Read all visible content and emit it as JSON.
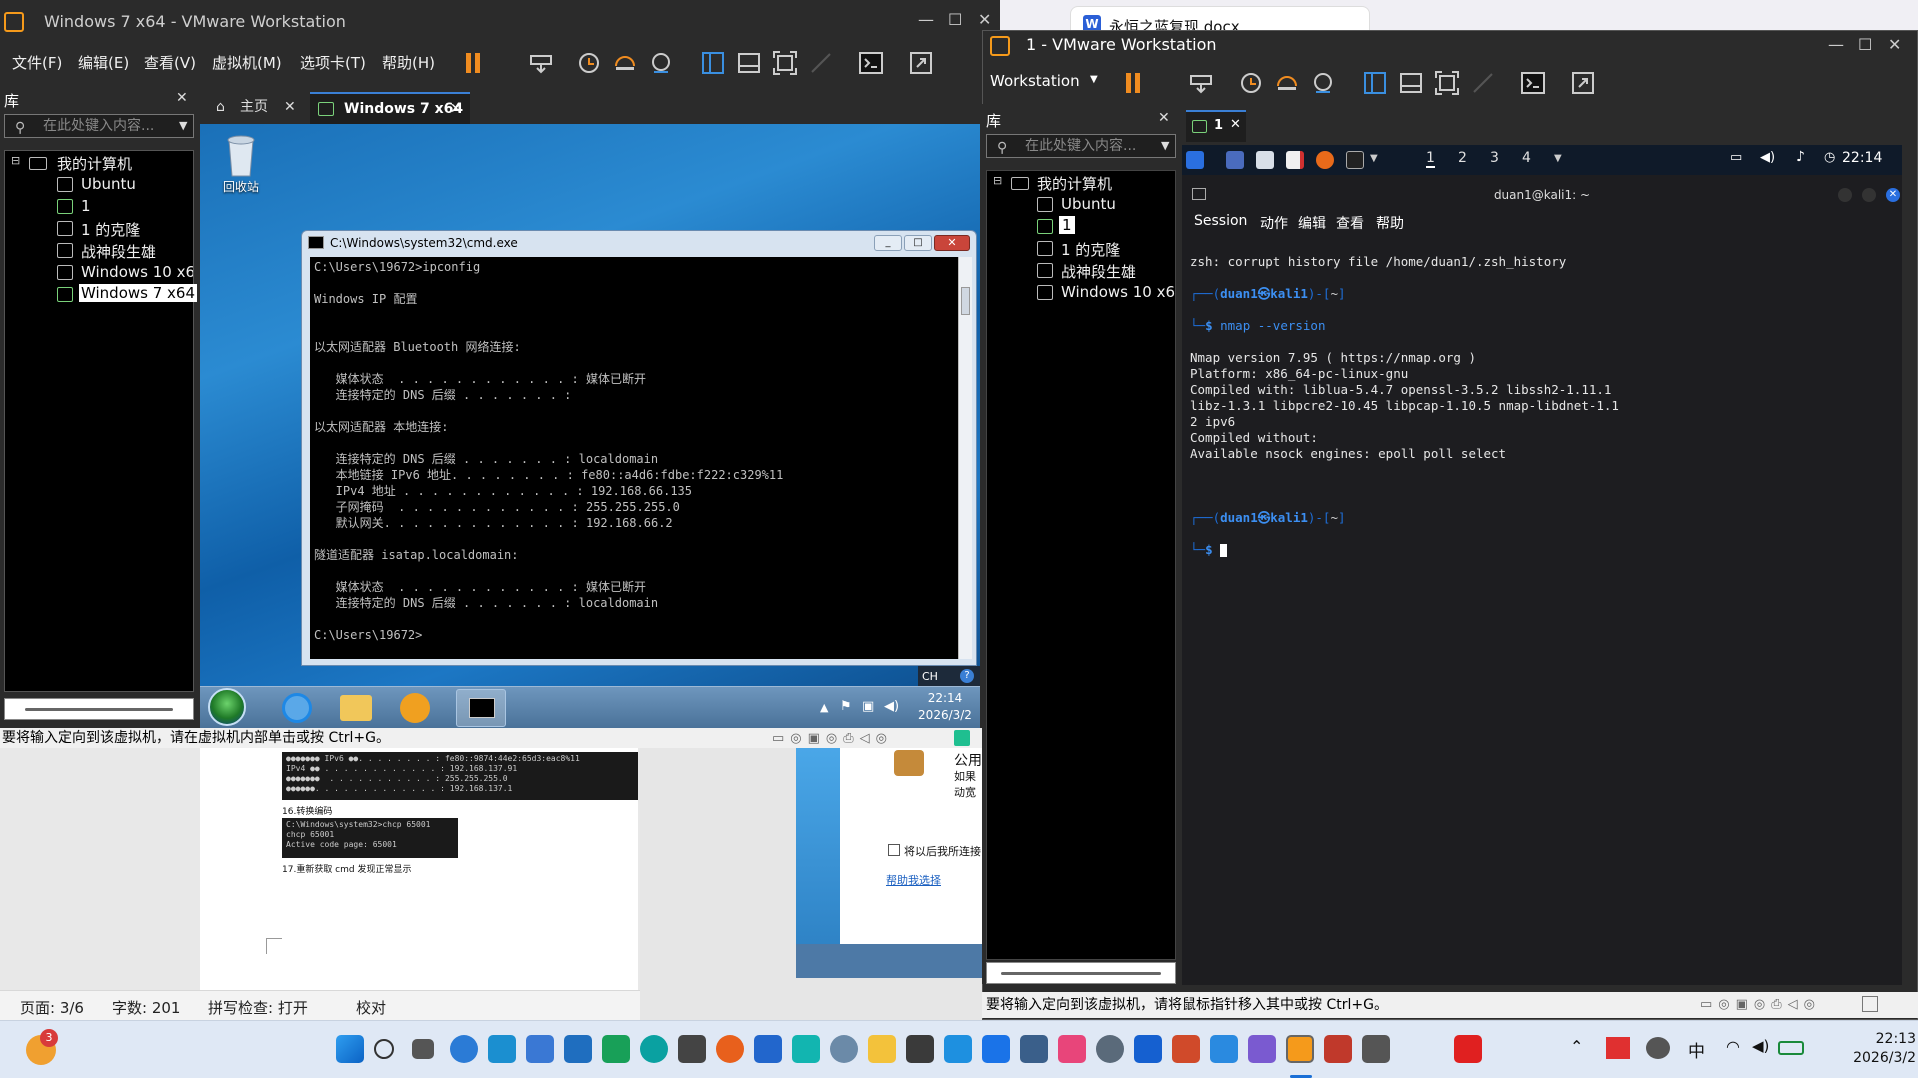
{
  "word_tab": {
    "title": "永恒之蓝复现.docx"
  },
  "word": {
    "status_page": "页面: 3/6",
    "status_words": "字数: 201",
    "status_spell": "拼写检查: 打开",
    "status_proof": "校对",
    "doc_img1": "●●●●●●● IPv6 ●●. . . . . . . . : fe80::9874:44e2:65d3:eac8%11\nIPv4 ●● . . . . . . . . . . . . : 192.168.137.91\n●●●●●●●  . . . . . . . . . . . : 255.255.255.0\n●●●●●●. . . . . . . . . . . . . : 192.168.137.1",
    "caption16": "16.转换编码",
    "doc_img2": "C:\\Windows\\system32>chcp 65001\nchcp 65001\nActive code page: 65001",
    "caption17": "17.重新获取 cmd 发现正常显示"
  },
  "vm_left": {
    "title": "Windows 7 x64 - VMware Workstation",
    "menu": [
      "文件(F)",
      "编辑(E)",
      "查看(V)",
      "虚拟机(M)",
      "选项卡(T)",
      "帮助(H)"
    ],
    "library": {
      "heading": "库",
      "search_placeholder": "在此处键入内容...",
      "root": "我的计算机",
      "items": [
        "Ubuntu",
        "1",
        "1 的克隆",
        "战神段生雄",
        "Windows 10 x64",
        "Windows 7 x64"
      ]
    },
    "tabs": [
      "主页",
      "Windows 7 x64"
    ],
    "desktop_icon": "回收站",
    "cmd": {
      "title": "C:\\Windows\\system32\\cmd.exe",
      "output": "C:\\Users\\19672>ipconfig\n\nWindows IP 配置\n\n\n以太网适配器 Bluetooth 网络连接:\n\n   媒体状态  . . . . . . . . . . . . : 媒体已断开\n   连接特定的 DNS 后缀 . . . . . . . :\n\n以太网适配器 本地连接:\n\n   连接特定的 DNS 后缀 . . . . . . . : localdomain\n   本地链接 IPv6 地址. . . . . . . . : fe80::a4d6:fdbe:f222:c329%11\n   IPv4 地址 . . . . . . . . . . . . : 192.168.66.135\n   子网掩码  . . . . . . . . . . . . : 255.255.255.0\n   默认网关. . . . . . . . . . . . . : 192.168.66.2\n\n隧道适配器 isatap.localdomain:\n\n   媒体状态  . . . . . . . . . . . . : 媒体已断开\n   连接特定的 DNS 后缀 . . . . . . . : localdomain\n\nC:\\Users\\19672>"
    },
    "tray_lang": "CH",
    "clock_time": "22:14",
    "clock_date": "2026/3/2",
    "message": "要将输入定向到该虚拟机，请在虚拟机内部单击或按 Ctrl+G。"
  },
  "vm_right": {
    "title": "1 - VMware Workstation",
    "workstation_menu": "Workstation",
    "library": {
      "heading": "库",
      "search_placeholder": "在此处键入内容...",
      "root": "我的计算机",
      "items": [
        "Ubuntu",
        "1",
        "1 的克隆",
        "战神段生雄",
        "Windows 10 x64"
      ]
    },
    "tab": "1",
    "kali_panel": {
      "workspaces": [
        "1",
        "2",
        "3",
        "4"
      ],
      "time": "22:14"
    },
    "terminal": {
      "window_title": "duan1@kali1: ~",
      "menu": [
        "Session",
        "动作",
        "编辑",
        "查看",
        "帮助"
      ],
      "line1": "zsh: corrupt history file /home/duan1/.zsh_history",
      "prompt_user": "duan1㉿kali1",
      "prompt_dir": "~",
      "command": "nmap --version",
      "output": "Nmap version 7.95 ( https://nmap.org )\nPlatform: x86_64-pc-linux-gnu\nCompiled with: liblua-5.4.7 openssl-3.5.2 libssh2-1.11.1\nlibz-1.3.1 libpcre2-10.45 libpcap-1.10.5 nmap-libdnet-1.1\n2 ipv6\nCompiled without:\nAvailable nsock engines: epoll poll select"
    },
    "message": "要将输入定向到该虚拟机，请将鼠标指针移入其中或按 Ctrl+G。"
  },
  "doc_popup": {
    "title": "公用",
    "line1": "如果",
    "line2": "动宽",
    "checkbox": "将以后我所连接",
    "link": "帮助我选择"
  },
  "taskbar": {
    "notif_count": "3",
    "ime": "中",
    "time": "22:13",
    "date": "2026/3/2"
  }
}
